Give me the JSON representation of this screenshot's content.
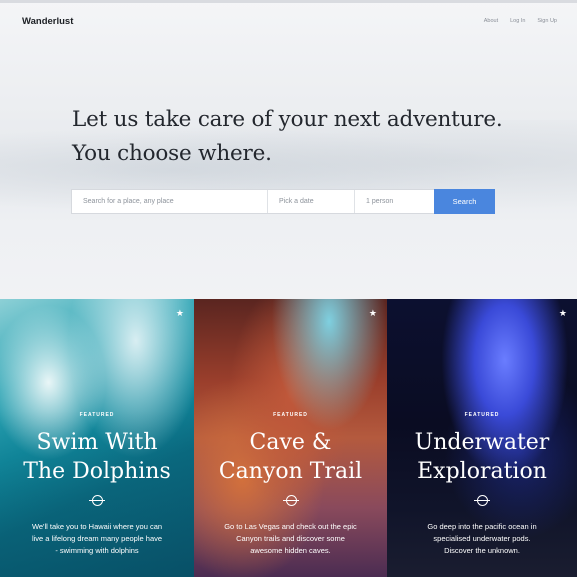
{
  "header": {
    "logo": "Wanderlust",
    "nav": [
      "About",
      "Log In",
      "Sign Up"
    ]
  },
  "hero": {
    "headline_line1": "Let us take care of your next adventure.",
    "headline_line2": "You choose where."
  },
  "search": {
    "place_placeholder": "Search for a place, any place",
    "date_placeholder": "Pick a date",
    "guests_value": "1 person",
    "button_label": "Search",
    "button_color": "#4a86de"
  },
  "cards": [
    {
      "label": "FEATURED",
      "title_line1": "Swim With",
      "title_line2": "The Dolphins",
      "desc_line1": "We'll take you to Hawaii where you can",
      "desc_line2": "live a lifelong dream many people have",
      "desc_line3": "- swimming with dolphins",
      "favorite_icon": "star-icon",
      "divider_icon": "circle-line-divider-icon"
    },
    {
      "label": "FEATURED",
      "title_line1": "Cave &",
      "title_line2": "Canyon Trail",
      "desc_line1": "Go to Las Vegas and check out the epic",
      "desc_line2": "Canyon trails and discover some",
      "desc_line3": "awesome hidden caves.",
      "favorite_icon": "star-icon",
      "divider_icon": "circle-line-divider-icon"
    },
    {
      "label": "FEATURED",
      "title_line1": "Underwater",
      "title_line2": "Exploration",
      "desc_line1": "Go deep into the pacific ocean in",
      "desc_line2": "specialised underwater pods.",
      "desc_line3": "Discover the unknown.",
      "favorite_icon": "star-icon",
      "divider_icon": "circle-line-divider-icon"
    }
  ]
}
